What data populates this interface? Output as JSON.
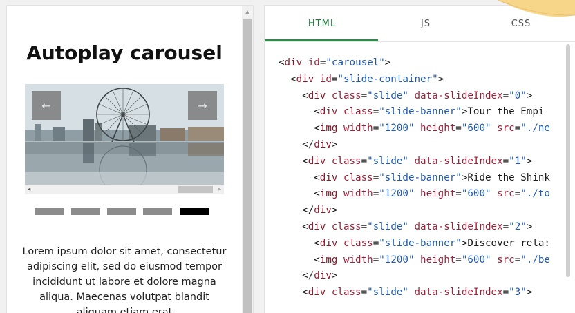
{
  "preview": {
    "title": "Autoplay carousel",
    "prev_arrow": "←",
    "next_arrow": "→",
    "body_text": "Lorem ipsum dolor sit amet, consectetur adipiscing elit, sed do eiusmod tempor incididunt ut labore et dolore magna aliqua. Maecenas volutpat blandit aliquam etiam erat",
    "dots": [
      {
        "active": false
      },
      {
        "active": false
      },
      {
        "active": false
      },
      {
        "active": false
      },
      {
        "active": true
      }
    ],
    "scroll_up_arrow": "▲",
    "hscroll_left": "◂",
    "hscroll_right": "▸"
  },
  "code_panel": {
    "tabs": [
      {
        "label": "HTML",
        "active": true
      },
      {
        "label": "JS",
        "active": false
      },
      {
        "label": "CSS",
        "active": false
      }
    ],
    "lines": [
      [
        [
          "t",
          "<"
        ],
        [
          "tag",
          "div"
        ],
        [
          "t",
          " "
        ],
        [
          "attr",
          "id"
        ],
        [
          "t",
          "="
        ],
        [
          "str",
          "\"carousel\""
        ],
        [
          "t",
          ">"
        ]
      ],
      [
        [
          "t",
          "  <"
        ],
        [
          "tag",
          "div"
        ],
        [
          "t",
          " "
        ],
        [
          "attr",
          "id"
        ],
        [
          "t",
          "="
        ],
        [
          "str",
          "\"slide-container\""
        ],
        [
          "t",
          ">"
        ]
      ],
      [
        [
          "t",
          "    <"
        ],
        [
          "tag",
          "div"
        ],
        [
          "t",
          " "
        ],
        [
          "attr",
          "class"
        ],
        [
          "t",
          "="
        ],
        [
          "str",
          "\"slide\""
        ],
        [
          "t",
          " "
        ],
        [
          "attr",
          "data-slideIndex"
        ],
        [
          "t",
          "="
        ],
        [
          "str",
          "\"0\""
        ],
        [
          "t",
          ">"
        ]
      ],
      [
        [
          "t",
          "      <"
        ],
        [
          "tag",
          "div"
        ],
        [
          "t",
          " "
        ],
        [
          "attr",
          "class"
        ],
        [
          "t",
          "="
        ],
        [
          "str",
          "\"slide-banner\""
        ],
        [
          "t",
          ">Tour the Empi"
        ]
      ],
      [
        [
          "t",
          "      <"
        ],
        [
          "tag",
          "img"
        ],
        [
          "t",
          " "
        ],
        [
          "attr",
          "width"
        ],
        [
          "t",
          "="
        ],
        [
          "str",
          "\"1200\""
        ],
        [
          "t",
          " "
        ],
        [
          "attr",
          "height"
        ],
        [
          "t",
          "="
        ],
        [
          "str",
          "\"600\""
        ],
        [
          "t",
          " "
        ],
        [
          "attr",
          "src"
        ],
        [
          "t",
          "="
        ],
        [
          "str",
          "\"./ne"
        ]
      ],
      [
        [
          "t",
          "    </"
        ],
        [
          "tag",
          "div"
        ],
        [
          "t",
          ">"
        ]
      ],
      [
        [
          "t",
          "    <"
        ],
        [
          "tag",
          "div"
        ],
        [
          "t",
          " "
        ],
        [
          "attr",
          "class"
        ],
        [
          "t",
          "="
        ],
        [
          "str",
          "\"slide\""
        ],
        [
          "t",
          " "
        ],
        [
          "attr",
          "data-slideIndex"
        ],
        [
          "t",
          "="
        ],
        [
          "str",
          "\"1\""
        ],
        [
          "t",
          ">"
        ]
      ],
      [
        [
          "t",
          "      <"
        ],
        [
          "tag",
          "div"
        ],
        [
          "t",
          " "
        ],
        [
          "attr",
          "class"
        ],
        [
          "t",
          "="
        ],
        [
          "str",
          "\"slide-banner\""
        ],
        [
          "t",
          ">Ride the Shink"
        ]
      ],
      [
        [
          "t",
          "      <"
        ],
        [
          "tag",
          "img"
        ],
        [
          "t",
          " "
        ],
        [
          "attr",
          "width"
        ],
        [
          "t",
          "="
        ],
        [
          "str",
          "\"1200\""
        ],
        [
          "t",
          " "
        ],
        [
          "attr",
          "height"
        ],
        [
          "t",
          "="
        ],
        [
          "str",
          "\"600\""
        ],
        [
          "t",
          " "
        ],
        [
          "attr",
          "src"
        ],
        [
          "t",
          "="
        ],
        [
          "str",
          "\"./to"
        ]
      ],
      [
        [
          "t",
          "    </"
        ],
        [
          "tag",
          "div"
        ],
        [
          "t",
          ">"
        ]
      ],
      [
        [
          "t",
          "    <"
        ],
        [
          "tag",
          "div"
        ],
        [
          "t",
          " "
        ],
        [
          "attr",
          "class"
        ],
        [
          "t",
          "="
        ],
        [
          "str",
          "\"slide\""
        ],
        [
          "t",
          " "
        ],
        [
          "attr",
          "data-slideIndex"
        ],
        [
          "t",
          "="
        ],
        [
          "str",
          "\"2\""
        ],
        [
          "t",
          ">"
        ]
      ],
      [
        [
          "t",
          "      <"
        ],
        [
          "tag",
          "div"
        ],
        [
          "t",
          " "
        ],
        [
          "attr",
          "class"
        ],
        [
          "t",
          "="
        ],
        [
          "str",
          "\"slide-banner\""
        ],
        [
          "t",
          ">Discover rela:"
        ]
      ],
      [
        [
          "t",
          "      <"
        ],
        [
          "tag",
          "img"
        ],
        [
          "t",
          " "
        ],
        [
          "attr",
          "width"
        ],
        [
          "t",
          "="
        ],
        [
          "str",
          "\"1200\""
        ],
        [
          "t",
          " "
        ],
        [
          "attr",
          "height"
        ],
        [
          "t",
          "="
        ],
        [
          "str",
          "\"600\""
        ],
        [
          "t",
          " "
        ],
        [
          "attr",
          "src"
        ],
        [
          "t",
          "="
        ],
        [
          "str",
          "\"./be"
        ]
      ],
      [
        [
          "t",
          "    </"
        ],
        [
          "tag",
          "div"
        ],
        [
          "t",
          ">"
        ]
      ],
      [
        [
          "t",
          "    <"
        ],
        [
          "tag",
          "div"
        ],
        [
          "t",
          " "
        ],
        [
          "attr",
          "class"
        ],
        [
          "t",
          "="
        ],
        [
          "str",
          "\"slide\""
        ],
        [
          "t",
          " "
        ],
        [
          "attr",
          "data-slideIndex"
        ],
        [
          "t",
          "="
        ],
        [
          "str",
          "\"3\""
        ],
        [
          "t",
          ">"
        ]
      ]
    ]
  }
}
